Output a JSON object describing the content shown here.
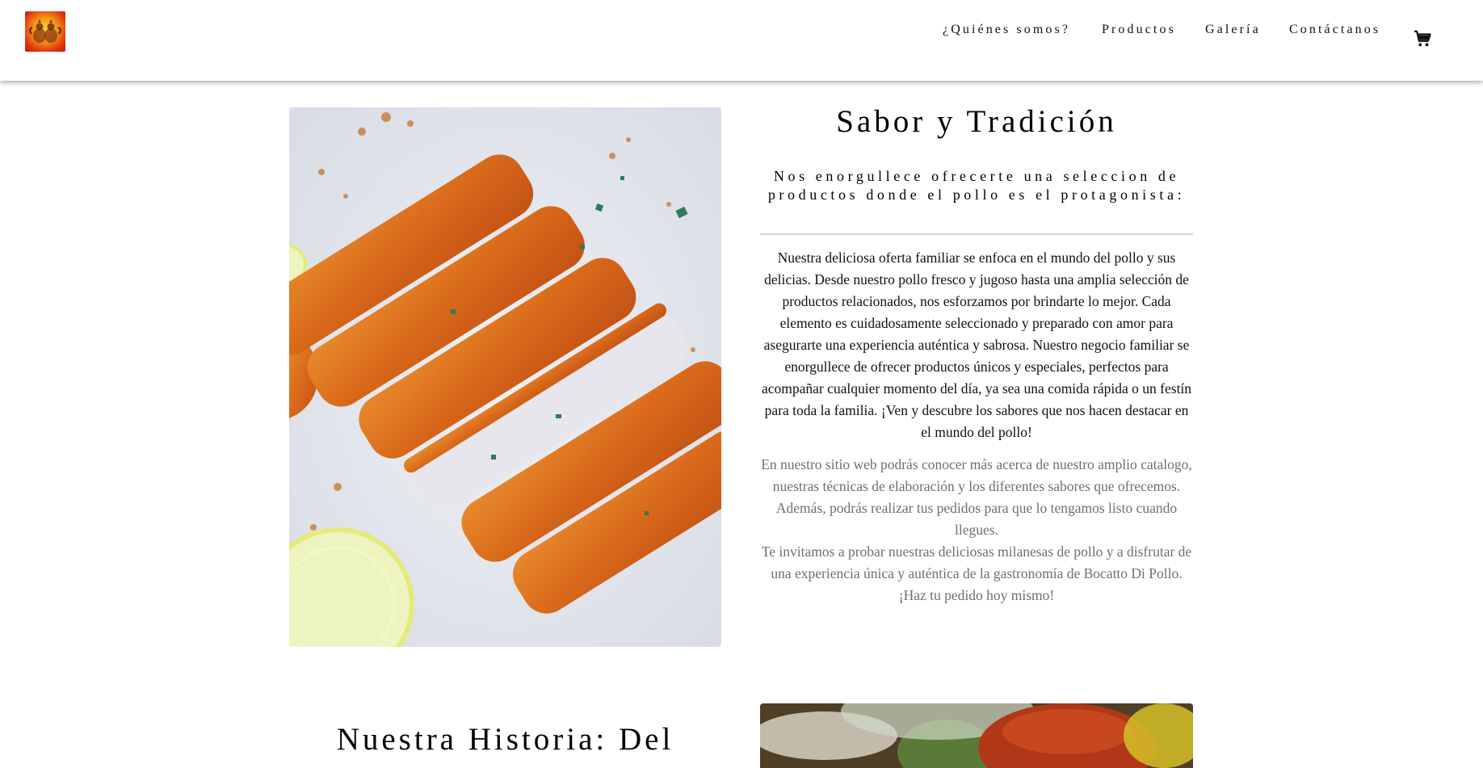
{
  "header": {
    "logo_alt": "Bocatto Di Pollo",
    "nav": [
      {
        "label": "¿Quiénes somos?"
      },
      {
        "label": "Productos"
      },
      {
        "label": "Galería"
      },
      {
        "label": "Contáctanos"
      }
    ],
    "cart_icon": "shopping-cart-icon"
  },
  "intro": {
    "title": "Sabor y Tradición",
    "subtitle": "Nos enorgullece ofrecerte una seleccion de productos donde el pollo es el protagonista:",
    "paragraph": "Nuestra deliciosa oferta familiar se enfoca en el mundo del pollo y sus delicias. Desde nuestro pollo fresco y jugoso hasta una amplia selección de productos relacionados, nos esforzamos por brindarte lo mejor. Cada elemento es cuidadosamente seleccionado y preparado con amor para asegurarte una experiencia auténtica y sabrosa. Nuestro negocio familiar se enorgullece de ofrecer productos únicos y especiales, perfectos para acompañar cualquier momento del día, ya sea una comida rápida o un festín para toda la familia. ¡Ven y descubre los sabores que nos hacen destacar en el mundo del pollo!",
    "secondary_lines": [
      "En nuestro sitio web podrás conocer más acerca de nuestro amplio catalogo, nuestras técnicas de elaboración y los diferentes sabores que ofrecemos. Además, podrás realizar tus pedidos para que lo tengamos listo cuando llegues.",
      "Te invitamos a probar nuestras deliciosas milanesas de pollo y a disfrutar de una experiencia única y auténtica de la gastronomía de Bocatto Di Pollo.",
      "¡Haz tu pedido hoy mismo!"
    ]
  },
  "history": {
    "title": "Nuestra Historia: Del"
  },
  "colors": {
    "text": "#000000",
    "muted_text": "#6f6f6f",
    "divider": "#d6d6d6",
    "header_bg": "#ffffff"
  }
}
